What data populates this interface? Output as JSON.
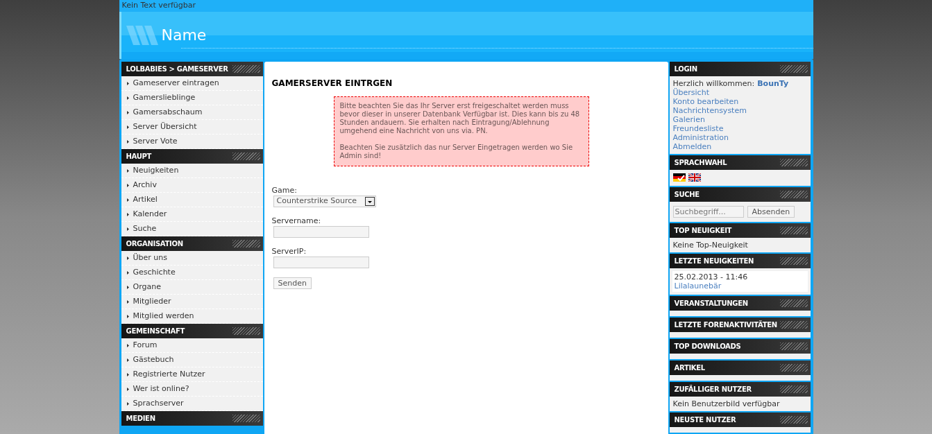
{
  "topbar": {
    "text": "Kein Text verfügbar"
  },
  "header": {
    "title": "Name"
  },
  "left_menu": [
    {
      "heading": "LOLBABIES > GAMESERVER",
      "items": [
        "Gameserver eintragen",
        "Gamerslieblinge",
        "Gamersabschaum",
        "Server Übersicht",
        "Server Vote"
      ]
    },
    {
      "heading": "HAUPT",
      "items": [
        "Neuigkeiten",
        "Archiv",
        "Artikel",
        "Kalender",
        "Suche"
      ]
    },
    {
      "heading": "ORGANISATION",
      "items": [
        "Über uns",
        "Geschichte",
        "Organe",
        "Mitglieder",
        "Mitglied werden"
      ]
    },
    {
      "heading": "GEMEINSCHAFT",
      "items": [
        "Forum",
        "Gästebuch",
        "Registrierte Nutzer",
        "Wer ist online?",
        "Sprachserver"
      ]
    },
    {
      "heading": "MEDIEN"
    }
  ],
  "main": {
    "title": "GAMERSERVER EINTRGEN",
    "notice": [
      "Bitte beachten Sie das Ihr Server erst freigeschaltet werden muss bevor dieser in unserer Datenbank Verfügbar ist. Dies kann bis zu 48 Stunden andauern. Sie erhalten nach Eintragung/Ablehnung umgehend eine Nachricht von uns via. PN.",
      "Beachten Sie zusätzlich das nur Server Eingetragen werden wo Sie Admin sind!"
    ],
    "fields": [
      {
        "kind": "select",
        "label": "Game:",
        "value": "Counterstrike Source"
      },
      {
        "kind": "text",
        "label": "Servername:"
      },
      {
        "kind": "text",
        "label": "ServerIP:"
      }
    ],
    "submit": "Senden"
  },
  "right_panels": [
    {
      "heading": "LOGIN",
      "kind": "login",
      "welcome": "Herzlich willkommen:",
      "user": "BounTy",
      "links": [
        "Übersicht",
        "Konto bearbeiten",
        "Nachrichtensystem",
        "Galerien",
        "Freundesliste",
        "Administration",
        "Abmelden"
      ]
    },
    {
      "heading": "SPRACHWAHL",
      "kind": "flags"
    },
    {
      "heading": "SUCHE",
      "kind": "search",
      "placeholder": "Suchbegriff...",
      "button": "Absenden"
    },
    {
      "heading": "TOP NEUIGKEIT",
      "kind": "text",
      "text": "Keine Top-Neuigkeit"
    },
    {
      "heading": "LETZTE NEUIGKEITEN",
      "kind": "news",
      "date": "25.02.2013 - 11:46",
      "title": "Lilalaunebär"
    },
    {
      "heading": "VERANSTALTUNGEN",
      "kind": "empty"
    },
    {
      "heading": "LETZTE FORENAKTIVITÄTEN",
      "kind": "empty"
    },
    {
      "heading": "TOP DOWNLOADS",
      "kind": "empty"
    },
    {
      "heading": "ARTIKEL",
      "kind": "empty"
    },
    {
      "heading": "ZUFÄLLIGER NUTZER",
      "kind": "text",
      "text": "Kein Benutzerbild verfügbar"
    },
    {
      "heading": "NEUSTE NUTZER",
      "kind": "empty"
    }
  ]
}
